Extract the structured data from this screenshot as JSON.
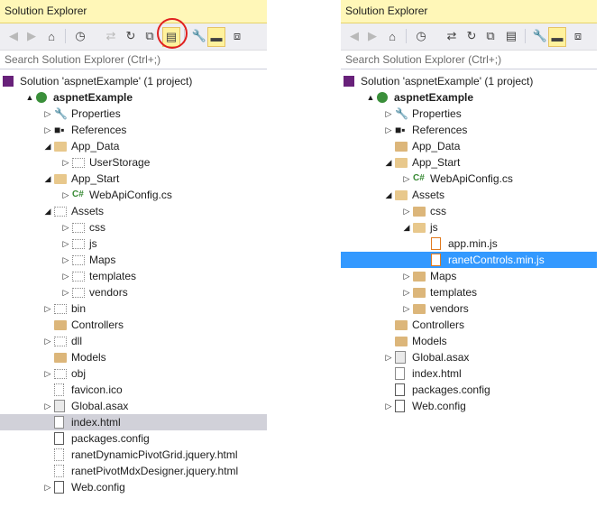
{
  "left": {
    "title": "Solution Explorer",
    "search_placeholder": "Search Solution Explorer (Ctrl+;)",
    "toolbar": [
      {
        "icon": "back-icon",
        "glyph": "◀",
        "dim": true
      },
      {
        "icon": "forward-icon",
        "glyph": "▶",
        "dim": true
      },
      {
        "icon": "home-icon",
        "glyph": "⌂",
        "dim": false
      },
      {
        "icon": "pending-changes-icon",
        "glyph": "◷",
        "dim": false
      },
      {
        "icon": "sync-icon",
        "glyph": "⇄",
        "dim": true
      },
      {
        "icon": "refresh-icon",
        "glyph": "↻",
        "dim": false
      },
      {
        "icon": "collapse-all-icon",
        "glyph": "⧉",
        "dim": false
      },
      {
        "icon": "show-all-files-icon",
        "glyph": "▤",
        "dim": false,
        "active": true
      },
      {
        "icon": "properties-icon",
        "glyph": "🔧",
        "dim": false
      },
      {
        "icon": "preview-icon",
        "glyph": "▬",
        "dim": false,
        "active": true
      },
      {
        "icon": "class-view-icon",
        "glyph": "⧈",
        "dim": false
      }
    ],
    "tree": [
      {
        "label": "Solution 'aspnetExample' (1 project)",
        "indent": 0,
        "exp": "",
        "icon": "solution-icon"
      },
      {
        "label": "aspnetExample",
        "indent": 1,
        "exp": "▲",
        "icon": "web-project-icon",
        "bold": true
      },
      {
        "label": "Properties",
        "indent": 2,
        "exp": "▷",
        "icon": "wrench-icon"
      },
      {
        "label": "References",
        "indent": 2,
        "exp": "▷",
        "icon": "references-icon"
      },
      {
        "label": "App_Data",
        "indent": 2,
        "exp": "◢",
        "icon": "folder-open-icon"
      },
      {
        "label": "UserStorage",
        "indent": 3,
        "exp": "▷",
        "icon": "folder-excluded-icon"
      },
      {
        "label": "App_Start",
        "indent": 2,
        "exp": "◢",
        "icon": "folder-open-icon"
      },
      {
        "label": "WebApiConfig.cs",
        "indent": 3,
        "exp": "▷",
        "icon": "csharp-file-icon"
      },
      {
        "label": "Assets",
        "indent": 2,
        "exp": "◢",
        "icon": "folder-excluded-icon"
      },
      {
        "label": "css",
        "indent": 3,
        "exp": "▷",
        "icon": "folder-excluded-icon"
      },
      {
        "label": "js",
        "indent": 3,
        "exp": "▷",
        "icon": "folder-excluded-icon"
      },
      {
        "label": "Maps",
        "indent": 3,
        "exp": "▷",
        "icon": "folder-excluded-icon"
      },
      {
        "label": "templates",
        "indent": 3,
        "exp": "▷",
        "icon": "folder-excluded-icon"
      },
      {
        "label": "vendors",
        "indent": 3,
        "exp": "▷",
        "icon": "folder-excluded-icon"
      },
      {
        "label": "bin",
        "indent": 2,
        "exp": "▷",
        "icon": "folder-excluded-icon"
      },
      {
        "label": "Controllers",
        "indent": 2,
        "exp": "",
        "icon": "folder-icon"
      },
      {
        "label": "dll",
        "indent": 2,
        "exp": "▷",
        "icon": "folder-excluded-icon"
      },
      {
        "label": "Models",
        "indent": 2,
        "exp": "",
        "icon": "folder-icon"
      },
      {
        "label": "obj",
        "indent": 2,
        "exp": "▷",
        "icon": "folder-excluded-icon"
      },
      {
        "label": "favicon.ico",
        "indent": 2,
        "exp": "",
        "icon": "file-excluded-icon"
      },
      {
        "label": "Global.asax",
        "indent": 2,
        "exp": "▷",
        "icon": "global-asax-icon"
      },
      {
        "label": "index.html",
        "indent": 2,
        "exp": "",
        "icon": "html-file-icon",
        "highlight": "gray"
      },
      {
        "label": "packages.config",
        "indent": 2,
        "exp": "",
        "icon": "config-file-icon"
      },
      {
        "label": "ranetDynamicPivotGrid.jquery.html",
        "indent": 2,
        "exp": "",
        "icon": "file-excluded-icon"
      },
      {
        "label": "ranetPivotMdxDesigner.jquery.html",
        "indent": 2,
        "exp": "",
        "icon": "file-excluded-icon"
      },
      {
        "label": "Web.config",
        "indent": 2,
        "exp": "▷",
        "icon": "config-file-icon"
      }
    ]
  },
  "right": {
    "title": "Solution Explorer",
    "search_placeholder": "Search Solution Explorer (Ctrl+;)",
    "toolbar": [
      {
        "icon": "back-icon",
        "glyph": "◀",
        "dim": true
      },
      {
        "icon": "forward-icon",
        "glyph": "▶",
        "dim": true
      },
      {
        "icon": "home-icon",
        "glyph": "⌂",
        "dim": false
      },
      {
        "icon": "pending-changes-icon",
        "glyph": "◷",
        "dim": false
      },
      {
        "icon": "sync-icon",
        "glyph": "⇄",
        "dim": false
      },
      {
        "icon": "refresh-icon",
        "glyph": "↻",
        "dim": false
      },
      {
        "icon": "collapse-all-icon",
        "glyph": "⧉",
        "dim": false
      },
      {
        "icon": "show-all-files-icon",
        "glyph": "▤",
        "dim": false
      },
      {
        "icon": "properties-icon",
        "glyph": "🔧",
        "dim": false
      },
      {
        "icon": "preview-icon",
        "glyph": "▬",
        "dim": false,
        "active": true
      },
      {
        "icon": "class-view-icon",
        "glyph": "⧈",
        "dim": false
      }
    ],
    "tree": [
      {
        "label": "Solution 'aspnetExample' (1 project)",
        "indent": 0,
        "exp": "",
        "icon": "solution-icon"
      },
      {
        "label": "aspnetExample",
        "indent": 1,
        "exp": "▲",
        "icon": "web-project-icon",
        "bold": true
      },
      {
        "label": "Properties",
        "indent": 2,
        "exp": "▷",
        "icon": "wrench-icon"
      },
      {
        "label": "References",
        "indent": 2,
        "exp": "▷",
        "icon": "references-icon"
      },
      {
        "label": "App_Data",
        "indent": 2,
        "exp": "",
        "icon": "folder-icon"
      },
      {
        "label": "App_Start",
        "indent": 2,
        "exp": "◢",
        "icon": "folder-open-icon"
      },
      {
        "label": "WebApiConfig.cs",
        "indent": 3,
        "exp": "▷",
        "icon": "csharp-file-icon"
      },
      {
        "label": "Assets",
        "indent": 2,
        "exp": "◢",
        "icon": "folder-open-icon"
      },
      {
        "label": "css",
        "indent": 3,
        "exp": "▷",
        "icon": "folder-icon"
      },
      {
        "label": "js",
        "indent": 3,
        "exp": "◢",
        "icon": "folder-open-icon"
      },
      {
        "label": "app.min.js",
        "indent": 4,
        "exp": "",
        "icon": "js-file-icon"
      },
      {
        "label": "ranetControls.min.js",
        "indent": 4,
        "exp": "",
        "icon": "js-file-icon",
        "highlight": "blue"
      },
      {
        "label": "Maps",
        "indent": 3,
        "exp": "▷",
        "icon": "folder-icon"
      },
      {
        "label": "templates",
        "indent": 3,
        "exp": "▷",
        "icon": "folder-icon"
      },
      {
        "label": "vendors",
        "indent": 3,
        "exp": "▷",
        "icon": "folder-icon"
      },
      {
        "label": "Controllers",
        "indent": 2,
        "exp": "",
        "icon": "folder-icon"
      },
      {
        "label": "Models",
        "indent": 2,
        "exp": "",
        "icon": "folder-icon"
      },
      {
        "label": "Global.asax",
        "indent": 2,
        "exp": "▷",
        "icon": "global-asax-icon"
      },
      {
        "label": "index.html",
        "indent": 2,
        "exp": "",
        "icon": "html-file-icon"
      },
      {
        "label": "packages.config",
        "indent": 2,
        "exp": "",
        "icon": "config-file-icon"
      },
      {
        "label": "Web.config",
        "indent": 2,
        "exp": "▷",
        "icon": "config-file-icon"
      }
    ]
  }
}
